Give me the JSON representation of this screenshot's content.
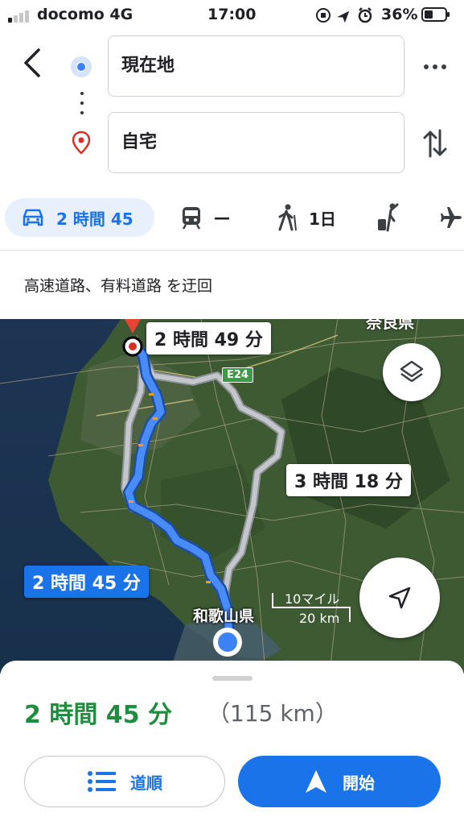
{
  "status_bar": {
    "carrier": "docomo  4G",
    "time": "17:00",
    "battery_percent": "36%"
  },
  "route_inputs": {
    "origin": "現在地",
    "destination": "自宅"
  },
  "travel_modes": [
    {
      "mode": "car-icon",
      "label": "2 時間 45",
      "selected": true
    },
    {
      "mode": "train-icon",
      "label": "—"
    },
    {
      "mode": "walk-icon",
      "label": "1日"
    },
    {
      "mode": "rideshare-icon",
      "label": ""
    },
    {
      "mode": "plane-icon",
      "label": ""
    }
  ],
  "route_note": "高速道路、有料道路 を迂回",
  "map": {
    "route_labels": {
      "alt1": "2 時間 49 分",
      "alt2": "3 時間 18 分",
      "selected": "2 時間 45 分"
    },
    "highway_badge": "E24",
    "prefecture_label": "和歌山県",
    "top_label": "奈良県",
    "scale": {
      "miles": "10マイル",
      "km": "20 km"
    }
  },
  "summary": {
    "duration": "2 時間 45 分",
    "distance": "（115 km）"
  },
  "buttons": {
    "steps": "道順",
    "start": "開始"
  },
  "colors": {
    "accent": "#1a73e8",
    "duration_green": "#1e8e3e",
    "route_blue": "#4a8cf7",
    "alt_route_gray": "#b8bcc0"
  }
}
